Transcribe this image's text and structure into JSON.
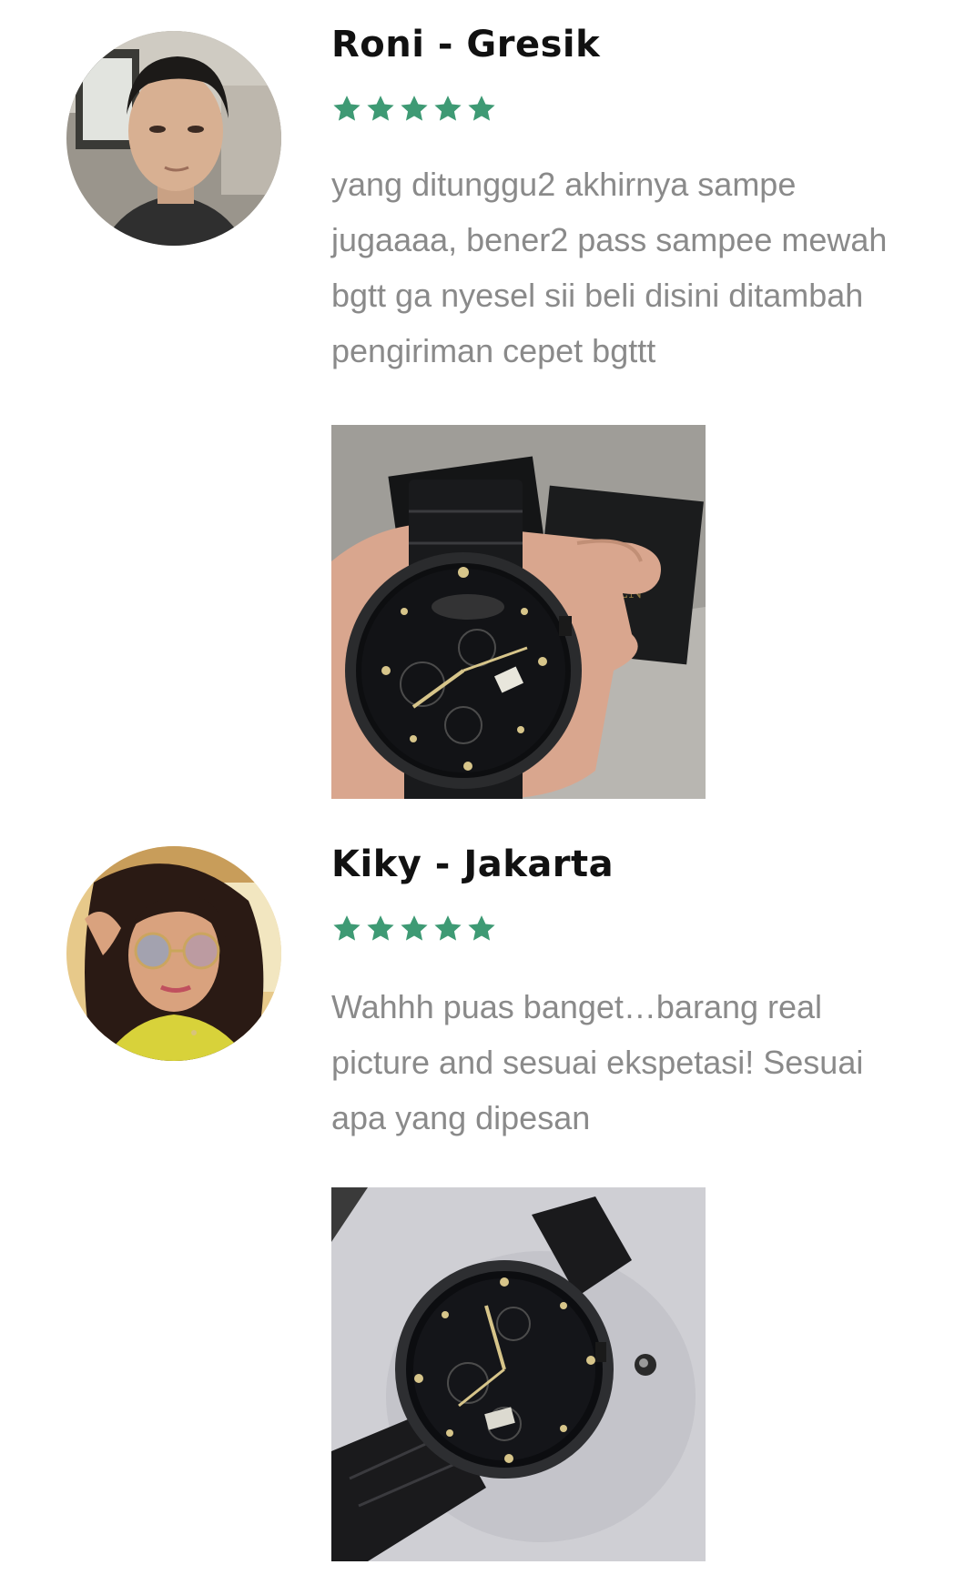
{
  "reviews": [
    {
      "name": "Roni - Gresik",
      "rating": 5,
      "text": "yang ditunggu2 akhirnya sampe jugaaaa, bener2 pass sampee mewah bgtt ga nyesel sii beli disini ditambah pengiriman cepet bgttt",
      "avatar_icon": "male-customer-avatar",
      "photo_icon": "black-watch-in-hand-photo"
    },
    {
      "name": "Kiky - Jakarta",
      "rating": 5,
      "text": "Wahhh puas banget…barang real picture and sesuai ekspetasi! Sesuai apa yang dipesan",
      "avatar_icon": "female-customer-avatar",
      "photo_icon": "black-watch-on-table-photo"
    }
  ],
  "colors": {
    "star": "#3e9a74",
    "name": "#111111",
    "text": "#8a8a8a"
  }
}
